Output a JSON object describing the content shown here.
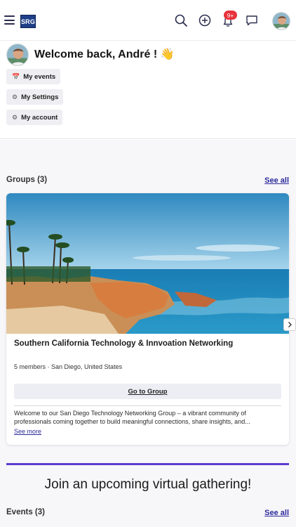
{
  "topbar": {
    "logo_text": "SRG",
    "notification_badge": "9+",
    "icons": [
      "menu-icon",
      "search-icon",
      "add-circle-icon",
      "bell-icon",
      "chat-icon",
      "avatar"
    ]
  },
  "welcome": {
    "title": "Welcome back, André ! 👋",
    "links": [
      {
        "label": "My events",
        "icon": "calendar-icon"
      },
      {
        "label": "My Settings",
        "icon": "settings-icon"
      },
      {
        "label": "My account",
        "icon": "gear-icon"
      }
    ]
  },
  "groups": {
    "title": "Groups (3)",
    "see_all": "See all",
    "card": {
      "title": "Southern California Technology & Innvoation Networking",
      "meta": "5 members · San Diego, United States",
      "button": "Go to Group",
      "description": "Welcome to our San Diego Technology Networking Group – a vibrant community of professionals coming together to build meaningful connections, share insights, and...",
      "see_more": "See more"
    }
  },
  "virtual": {
    "title": "Join an upcoming virtual gathering!"
  },
  "events": {
    "title": "Events (3)",
    "see_all": "See all"
  },
  "colors": {
    "accent": "#5c3bd0",
    "link": "#2b2a9e",
    "badge": "#e8323c",
    "logo_bg": "#1e3f87"
  }
}
